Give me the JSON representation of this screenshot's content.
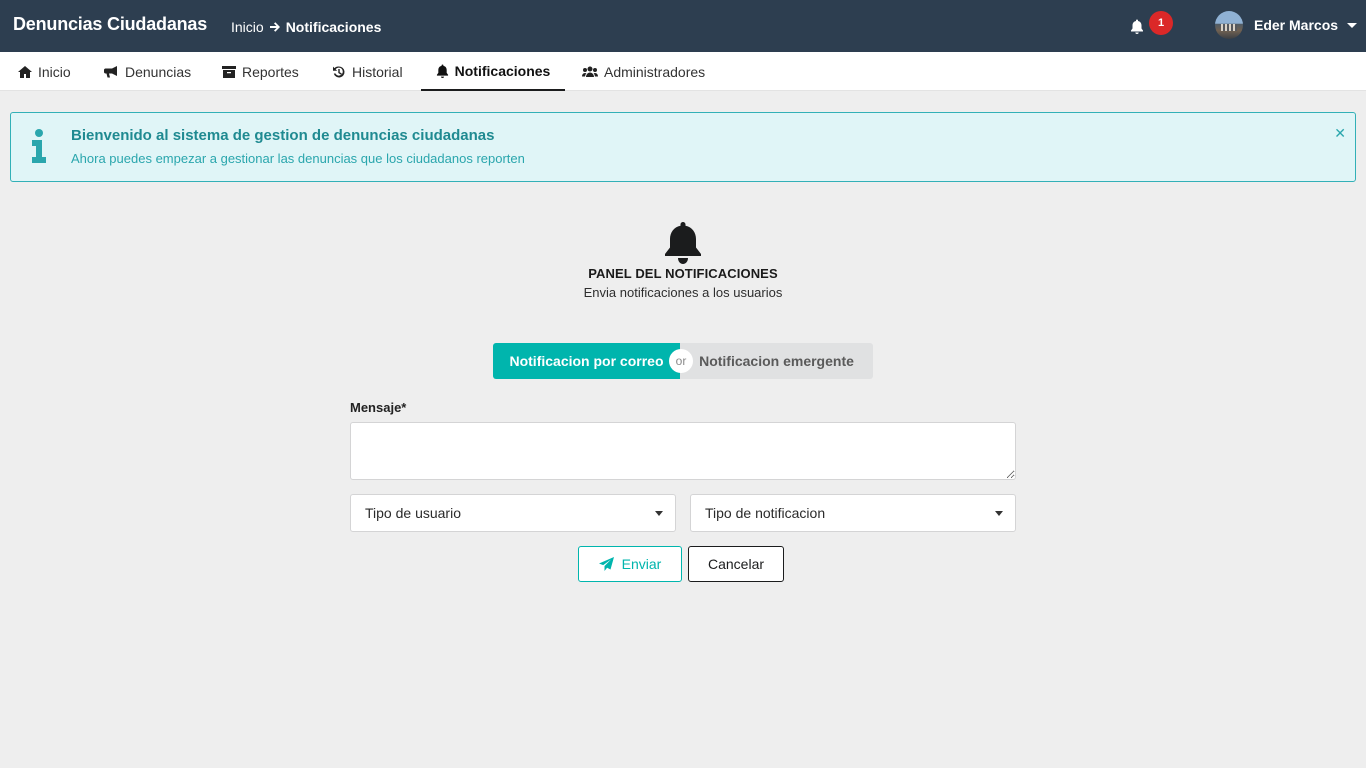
{
  "app": {
    "title": "Denuncias Ciudadanas"
  },
  "breadcrumb": {
    "home": "Inicio",
    "current": "Notificaciones"
  },
  "notifications": {
    "count": "1",
    "icon": "bell-icon"
  },
  "user": {
    "name": "Eder Marcos"
  },
  "nav": {
    "items": [
      {
        "label": "Inicio",
        "icon": "home-icon"
      },
      {
        "label": "Denuncias",
        "icon": "bullhorn-icon"
      },
      {
        "label": "Reportes",
        "icon": "archive-icon"
      },
      {
        "label": "Historial",
        "icon": "history-icon"
      },
      {
        "label": "Notificaciones",
        "icon": "bell-icon",
        "active": true
      },
      {
        "label": "Administradores",
        "icon": "users-icon"
      }
    ]
  },
  "alert": {
    "title": "Bienvenido al sistema de gestion de denuncias ciudadanas",
    "text": "Ahora puedes empezar a gestionar las denuncias que los ciudadanos reporten"
  },
  "panel": {
    "title": "PANEL DEL NOTIFICACIONES",
    "subtitle": "Envia notificaciones a los usuarios"
  },
  "toggle": {
    "option1": "Notificacion por correo",
    "or": "or",
    "option2": "Notificacion emergente"
  },
  "form": {
    "message_label": "Mensaje*",
    "message_value": "",
    "user_type": "Tipo de usuario",
    "notification_type": "Tipo de notificacion",
    "send_label": "Enviar",
    "cancel_label": "Cancelar"
  },
  "colors": {
    "topbar": "#2d3e50",
    "accent": "#00b5ad",
    "badge": "#db2828",
    "alert_bg": "#e0f5f7",
    "alert_border": "#32b0b7"
  }
}
